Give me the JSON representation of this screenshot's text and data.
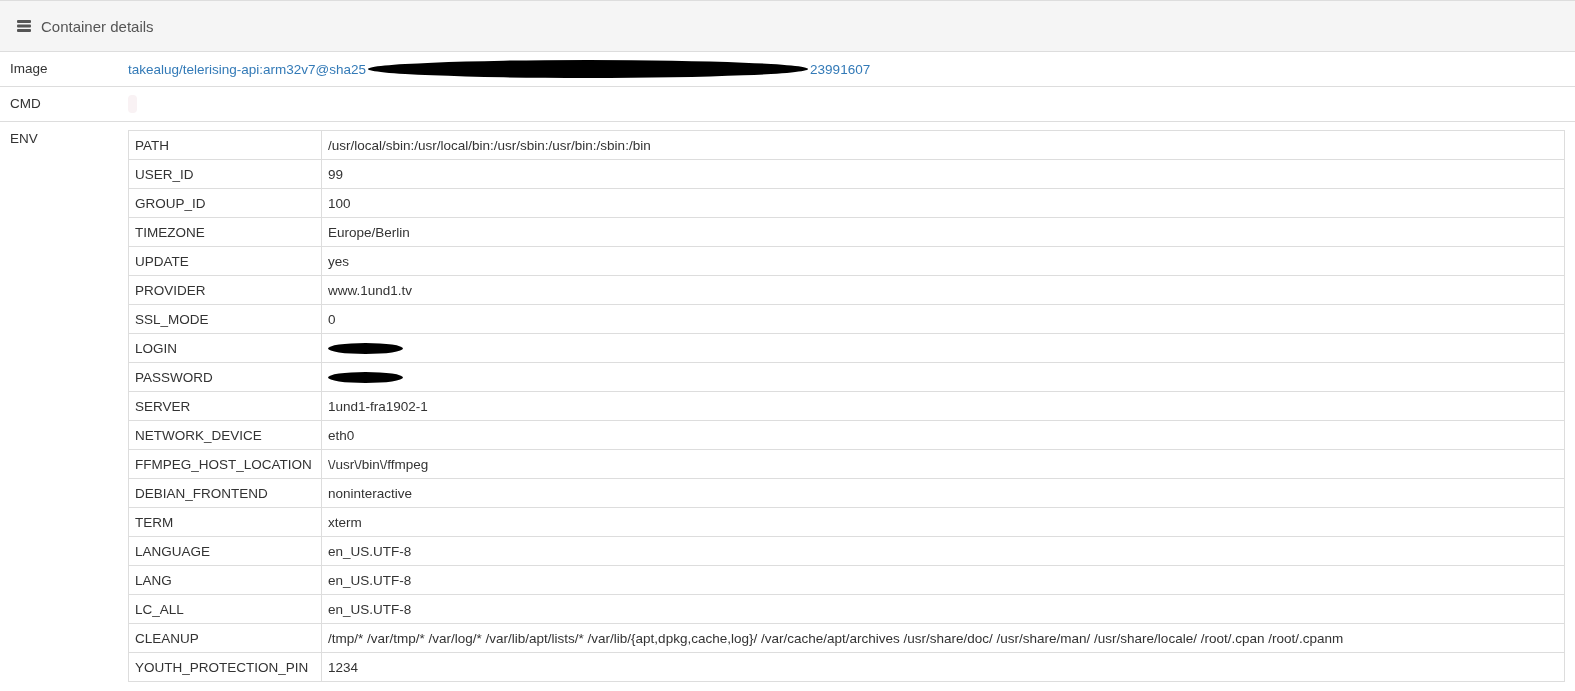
{
  "panel": {
    "title": "Container details"
  },
  "details": [
    {
      "label": "Image",
      "kind": "link",
      "prefix": "takealug/telerising-api:arm32v7@sha25",
      "suffix": "23991607",
      "redacted": true
    },
    {
      "label": "CMD",
      "kind": "empty"
    },
    {
      "label": "ENV",
      "kind": "table"
    }
  ],
  "env": [
    {
      "key": "PATH",
      "value": "/usr/local/sbin:/usr/local/bin:/usr/sbin:/usr/bin:/sbin:/bin",
      "redacted": false
    },
    {
      "key": "USER_ID",
      "value": "99",
      "redacted": false
    },
    {
      "key": "GROUP_ID",
      "value": "100",
      "redacted": false
    },
    {
      "key": "TIMEZONE",
      "value": "Europe/Berlin",
      "redacted": false
    },
    {
      "key": "UPDATE",
      "value": "yes",
      "redacted": false
    },
    {
      "key": "PROVIDER",
      "value": "www.1und1.tv",
      "redacted": false
    },
    {
      "key": "SSL_MODE",
      "value": "0",
      "redacted": false
    },
    {
      "key": "LOGIN",
      "redacted": true
    },
    {
      "key": "PASSWORD",
      "redacted": true
    },
    {
      "key": "SERVER",
      "value": "1und1-fra1902-1",
      "redacted": false
    },
    {
      "key": "NETWORK_DEVICE",
      "value": "eth0",
      "redacted": false
    },
    {
      "key": "FFMPEG_HOST_LOCATION",
      "value": "\\/usr\\/bin\\/ffmpeg",
      "redacted": false
    },
    {
      "key": "DEBIAN_FRONTEND",
      "value": "noninteractive",
      "redacted": false
    },
    {
      "key": "TERM",
      "value": "xterm",
      "redacted": false
    },
    {
      "key": "LANGUAGE",
      "value": "en_US.UTF-8",
      "redacted": false
    },
    {
      "key": "LANG",
      "value": "en_US.UTF-8",
      "redacted": false
    },
    {
      "key": "LC_ALL",
      "value": "en_US.UTF-8",
      "redacted": false
    },
    {
      "key": "CLEANUP",
      "value": "/tmp/* /var/tmp/* /var/log/* /var/lib/apt/lists/* /var/lib/{apt,dpkg,cache,log}/ /var/cache/apt/archives /usr/share/doc/ /usr/share/man/ /usr/share/locale/ /root/.cpan /root/.cpanm",
      "redacted": false
    },
    {
      "key": "YOUTH_PROTECTION_PIN",
      "value": "1234",
      "redacted": false
    }
  ]
}
